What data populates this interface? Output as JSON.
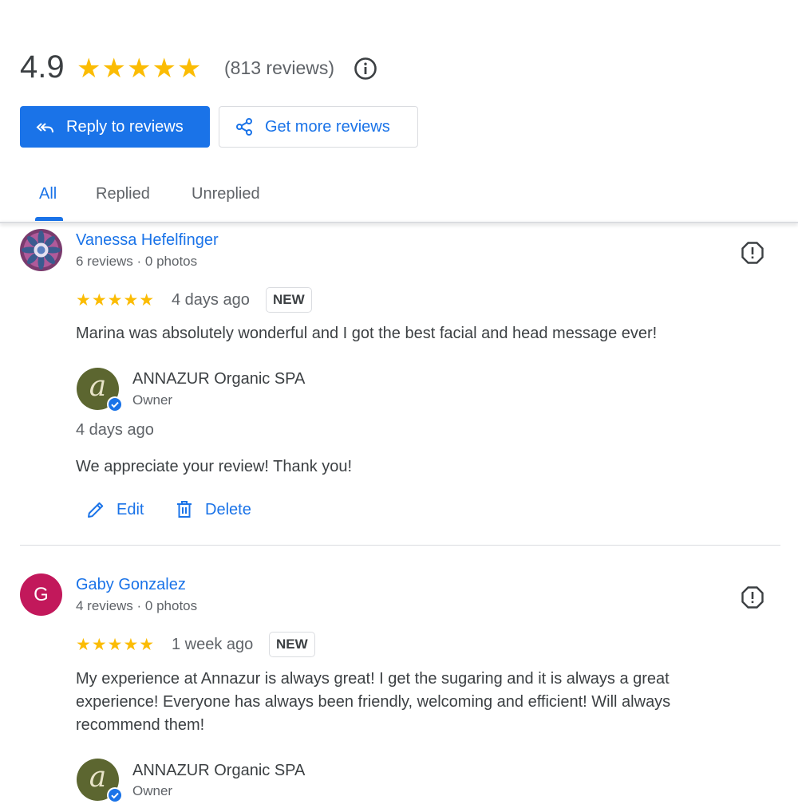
{
  "summary": {
    "rating": "4.9",
    "stars": "★★★★★",
    "review_count": "(813 reviews)"
  },
  "actions": {
    "reply_label": "Reply to reviews",
    "more_label": "Get more reviews"
  },
  "tabs": [
    {
      "label": "All",
      "active": true
    },
    {
      "label": "Replied",
      "active": false
    },
    {
      "label": "Unreplied",
      "active": false
    }
  ],
  "reviews": [
    {
      "name": "Vanessa Hefelfinger",
      "meta": "6 reviews · 0 photos",
      "stars": "★★★★★",
      "date": "4 days ago",
      "badge": "NEW",
      "text": "Marina was absolutely wonderful and I got the best facial and head message ever!",
      "reply": {
        "owner_name": "ANNAZUR Organic SPA",
        "owner_role": "Owner",
        "date": "4 days ago",
        "text": "We appreciate your review! Thank you!",
        "edit_label": "Edit",
        "delete_label": "Delete"
      }
    },
    {
      "name": "Gaby Gonzalez",
      "avatar_letter": "G",
      "meta": "4 reviews · 0 photos",
      "stars": "★★★★★",
      "date": "1 week ago",
      "badge": "NEW",
      "text": "My experience at Annazur is always great! I get the sugaring and it is always a great experience! Everyone has always been friendly, welcoming and efficient! Will always recommend them!",
      "reply": {
        "owner_name": "ANNAZUR Organic SPA",
        "owner_role": "Owner"
      }
    }
  ],
  "colors": {
    "accent": "#1a73e8",
    "star": "#fbbc04",
    "avatar_g": "#c2185b",
    "owner_avatar": "#5c6630"
  },
  "icons": [
    "reply-all-icon",
    "share-icon",
    "info-icon",
    "report-flag-icon",
    "edit-pencil-icon",
    "delete-trash-icon",
    "verified-badge-icon"
  ]
}
